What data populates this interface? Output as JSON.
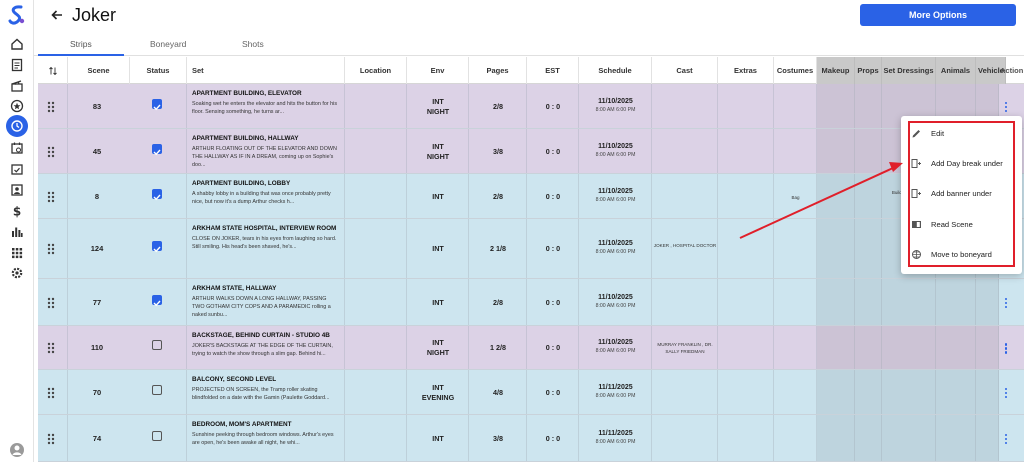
{
  "header": {
    "title": "Joker",
    "more_options_label": "More Options"
  },
  "tabs": [
    {
      "label": "Strips",
      "active": true
    },
    {
      "label": "Boneyard",
      "active": false
    },
    {
      "label": "Shots",
      "active": false
    }
  ],
  "columns": {
    "scene": "Scene",
    "status": "Status",
    "set": "Set",
    "location": "Location",
    "env": "Env",
    "pages": "Pages",
    "est": "EST",
    "schedule": "Schedule",
    "cast": "Cast",
    "extras": "Extras",
    "costumes": "Costumes",
    "makeup": "Makeup",
    "props": "Props",
    "set_dressings": "Set Dressings",
    "animals": "Animals",
    "vehicles": "Vehicles",
    "action": "Action G"
  },
  "rows": [
    {
      "scene": "83",
      "checked": true,
      "set_title": "APARTMENT BUILDING, ELEVATOR",
      "set_desc": "Soaking wet he enters the elevator and hits the button for his floor. Sensing something, he turns ar...",
      "env": "INT\nNIGHT",
      "pages": "2/8",
      "est": "0 : 0",
      "date": "11/10/2025",
      "time": "8:00 AM 6:00 PM",
      "cast": "",
      "costumes": "",
      "set_dressings": "",
      "color": "purple"
    },
    {
      "scene": "45",
      "checked": true,
      "set_title": "APARTMENT BUILDING, HALLWAY",
      "set_desc": "ARTHUR FLOATING OUT OF THE ELEVATOR AND DOWN THE HALLWAY AS IF IN A DREAM, coming up on Sophie's doo...",
      "env": "INT\nNIGHT",
      "pages": "3/8",
      "est": "0 : 0",
      "date": "11/10/2025",
      "time": "8:00 AM 6:00 PM",
      "cast": "",
      "costumes": "",
      "set_dressings": "",
      "color": "purple"
    },
    {
      "scene": "8",
      "checked": true,
      "set_title": "APARTMENT BUILDING, LOBBY",
      "set_desc": "A shabby lobby in a building that was once probably pretty nice, but now it's a dump Arthur checks h...",
      "env": "INT",
      "pages": "2/8",
      "est": "0 : 0",
      "date": "11/10/2025",
      "time": "8:00 AM 6:00 PM",
      "cast": "",
      "costumes": "Bag",
      "set_dressings": "Building ... Dump",
      "color": "blue"
    },
    {
      "scene": "124",
      "checked": true,
      "set_title": "ARKHAM STATE HOSPITAL, INTERVIEW ROOM",
      "set_desc": "CLOSE ON JOKER, tears in his eyes from laughing so hard. Still smiling. His head's been shaved, he's...",
      "env": "INT",
      "pages": "2 1/8",
      "est": "0 : 0",
      "date": "11/10/2025",
      "time": "8:00 AM 6:00 PM",
      "cast": "JOKER , HOSPITAL DOCTOR",
      "costumes": "",
      "set_dressings": "",
      "color": "blue"
    },
    {
      "scene": "77",
      "checked": true,
      "set_title": "ARKHAM STATE, HALLWAY",
      "set_desc": "ARTHUR WALKS DOWN A LONG HALLWAY, PASSING TWO GOTHAM CITY COPS AND A PARAMEDIC rolling a naked sunbu...",
      "env": "INT",
      "pages": "2/8",
      "est": "0 : 0",
      "date": "11/10/2025",
      "time": "8:00 AM 6:00 PM",
      "cast": "",
      "costumes": "",
      "set_dressings": "",
      "color": "blue"
    },
    {
      "scene": "110",
      "checked": false,
      "set_title": "BACKSTAGE, BEHIND CURTAIN - STUDIO 4B",
      "set_desc": "JOKER'S BACKSTAGE AT THE EDGE OF THE CURTAIN, trying to watch the show through a slim gap. Behind hi...",
      "env": "INT\nNIGHT",
      "pages": "1 2/8",
      "est": "0 : 0",
      "date": "11/10/2025",
      "time": "8:00 AM 6:00 PM",
      "cast": "MURRAY FRANKLIN , DR. SALLY FRIEDMAN",
      "costumes": "",
      "set_dressings": "",
      "color": "purple"
    },
    {
      "scene": "70",
      "checked": false,
      "set_title": "BALCONY, SECOND LEVEL",
      "set_desc": "PROJECTED ON SCREEN, the Tramp roller skating blindfolded on a date with the Gamin (Paulette Goddard...",
      "env": "INT\nEVENING",
      "pages": "4/8",
      "est": "0 : 0",
      "date": "11/11/2025",
      "time": "8:00 AM 6:00 PM",
      "cast": "",
      "costumes": "",
      "set_dressings": "",
      "color": "blue"
    },
    {
      "scene": "74",
      "checked": false,
      "set_title": "BEDROOM, MOM'S APARTMENT",
      "set_desc": "Sunshine peeking through bedroom windows. Arthur's eyes are open, he's been awake all night, he whi...",
      "env": "INT",
      "pages": "3/8",
      "est": "0 : 0",
      "date": "11/11/2025",
      "time": "8:00 AM 6:00 PM",
      "cast": "",
      "costumes": "",
      "set_dressings": "",
      "color": "blue"
    }
  ],
  "context_menu": [
    {
      "label": "Edit",
      "icon": "pencil-icon"
    },
    {
      "label": "Add Day break under",
      "icon": "day-break-icon"
    },
    {
      "label": "Add banner under",
      "icon": "banner-icon"
    },
    {
      "label": "Read Scene",
      "icon": "read-scene-icon"
    },
    {
      "label": "Move to boneyard",
      "icon": "boneyard-icon"
    }
  ],
  "colors": {
    "accent": "#2a62e6",
    "highlight": "#e01f2a",
    "row_purple": "#dcd2e6",
    "row_blue": "#cde5ef"
  }
}
